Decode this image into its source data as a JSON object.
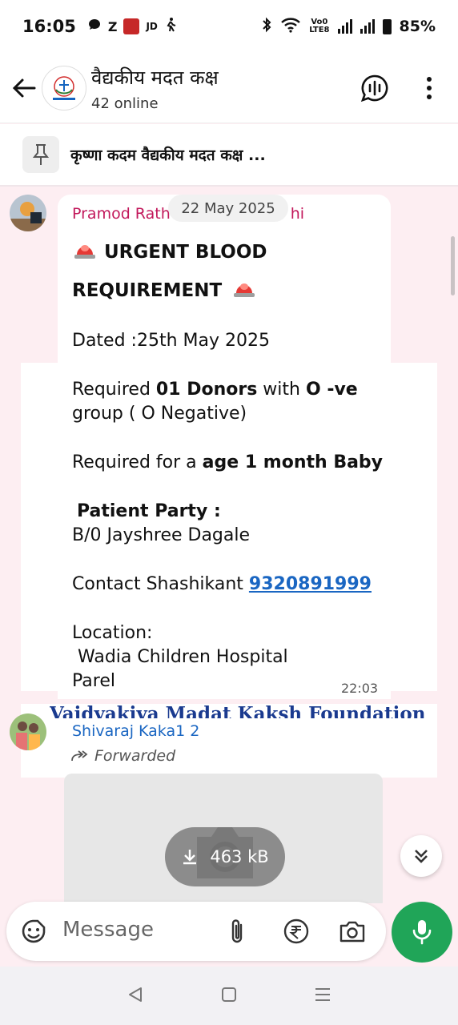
{
  "status_bar": {
    "time": "16:05",
    "left_icons": [
      "message-icon",
      "z-app-icon",
      "app-icon",
      "walk-icon"
    ],
    "jd_label": "JD",
    "z_label": "Z",
    "volte_label": "Vo0\nLTE8",
    "battery": "85%"
  },
  "header": {
    "title": "वैद्यकीय मदत कक्ष",
    "subtitle": "42 online"
  },
  "pinned": {
    "text": "कृष्णा कदम वैद्यकीय मदत कक्ष ..."
  },
  "date_chip": "22 May 2025",
  "message1": {
    "sender": "Pramod Rathod Mahadev Rathi",
    "sender_visible": "Pramod Rath",
    "sender_tail": "hi",
    "line_urgent_1": "URGENT BLOOD",
    "line_urgent_2": "REQUIREMENT",
    "dated": "Dated :25th May 2025",
    "req_prefix": "Required ",
    "req_donors": "01 Donors",
    "req_with": " with ",
    "req_group": "O -ve",
    "req_group_line": "group  ( O Negative)",
    "req_for_prefix": "Required for a ",
    "req_for_bold": "age 1 month Baby",
    "patient_party_label": "Patient Party :",
    "patient_name": "B/0 Jayshree Dagale",
    "contact_prefix": "Contact  Shashikant ",
    "contact_phone": "9320891999",
    "location_label": "Location:",
    "location_line1": " Wadia Children Hospital",
    "location_line2": "Parel",
    "time": "22:03"
  },
  "banner_text": "Vaidyakiya Madat Kaksh Foundation",
  "message2": {
    "sender": "Shivaraj Kaka1 2",
    "forwarded": "Forwarded",
    "media_size": "463 kB"
  },
  "composer": {
    "placeholder": "Message"
  },
  "colors": {
    "chat_bg": "#fdeef2",
    "sender1": "#c2185b",
    "sender2": "#1a66c2",
    "link": "#1a66c2",
    "mic": "#20a558"
  }
}
